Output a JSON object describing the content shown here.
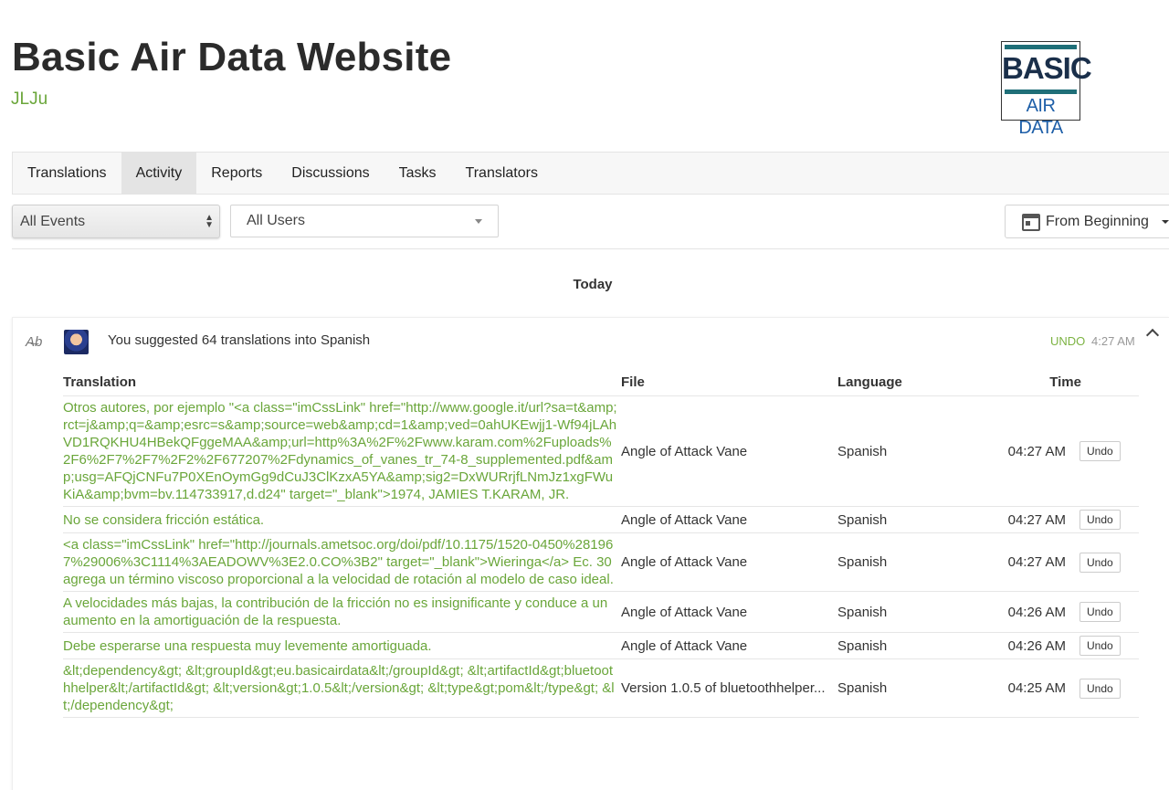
{
  "header": {
    "title": "Basic Air Data Website",
    "subtitle": "JLJu",
    "logo": {
      "line1": "BASIC",
      "line2": "AIR DATA"
    }
  },
  "tabs": [
    {
      "label": "Translations",
      "active": false
    },
    {
      "label": "Activity",
      "active": true
    },
    {
      "label": "Reports",
      "active": false
    },
    {
      "label": "Discussions",
      "active": false
    },
    {
      "label": "Tasks",
      "active": false
    },
    {
      "label": "Translators",
      "active": false
    }
  ],
  "filters": {
    "events": "All Events",
    "users": "All Users",
    "date_range": "From Beginning"
  },
  "day_label": "Today",
  "activity": {
    "summary": "You suggested 64 translations into Spanish",
    "undo_label": "UNDO",
    "time": "4:27 AM",
    "columns": {
      "translation": "Translation",
      "file": "File",
      "language": "Language",
      "time": "Time"
    },
    "undo_button": "Undo",
    "rows": [
      {
        "text": "Otros autores, por ejemplo \"<a class=\"imCssLink\" href=\"http://www.google.it/url?sa=t&amp;rct=j&amp;q=&amp;esrc=s&amp;source=web&amp;cd=1&amp;ved=0ahUKEwjj1-Wf94jLAhVD1RQKHU4HBekQFggeMAA&amp;url=http%3A%2F%2Fwww.karam.com%2Fuploads%2F6%2F7%2F7%2F2%2F677207%2Fdynamics_of_vanes_tr_74-8_supplemented.pdf&amp;usg=AFQjCNFu7P0XEnOymGg9dCuJ3ClKzxA5YA&amp;sig2=DxWURrjfLNmJz1xgFWuKiA&amp;bvm=bv.114733917,d.d24\" target=\"_blank\">1974, JAMIES T.KARAM, JR.",
        "file": "Angle of Attack Vane",
        "language": "Spanish",
        "time": "04:27 AM"
      },
      {
        "text": "No se considera fricción estática.",
        "file": "Angle of Attack Vane",
        "language": "Spanish",
        "time": "04:27 AM"
      },
      {
        "text": "<a class=\"imCssLink\" href=\"http://journals.ametsoc.org/doi/pdf/10.1175/1520-0450%281967%29006%3C1114%3AEADOWV%3E2.0.CO%3B2\" target=\"_blank\">Wieringa</a> Ec. 30 agrega un término viscoso proporcional a la velocidad de rotación al modelo de caso ideal.",
        "file": "Angle of Attack Vane",
        "language": "Spanish",
        "time": "04:27 AM"
      },
      {
        "text": "A velocidades más bajas, la contribución de la fricción no es insignificante y conduce a un aumento en la amortiguación de la respuesta.",
        "file": "Angle of Attack Vane",
        "language": "Spanish",
        "time": "04:26 AM"
      },
      {
        "text": "Debe esperarse una respuesta muy levemente amortiguada.",
        "file": "Angle of Attack Vane",
        "language": "Spanish",
        "time": "04:26 AM"
      },
      {
        "text": "&lt;dependency&gt; &lt;groupId&gt;eu.basicairdata&lt;/groupId&gt; &lt;artifactId&gt;bluetoothhelper&lt;/artifactId&gt; &lt;version&gt;1.0.5&lt;/version&gt; &lt;type&gt;pom&lt;/type&gt; &lt;/dependency&gt;",
        "file": "Version 1.0.5 of bluetoothhelper...",
        "language": "Spanish",
        "time": "04:25 AM"
      }
    ]
  },
  "colors": {
    "accent_green": "#6aa63a",
    "undo_green": "#7cb342",
    "title": "#2b2b2b"
  }
}
